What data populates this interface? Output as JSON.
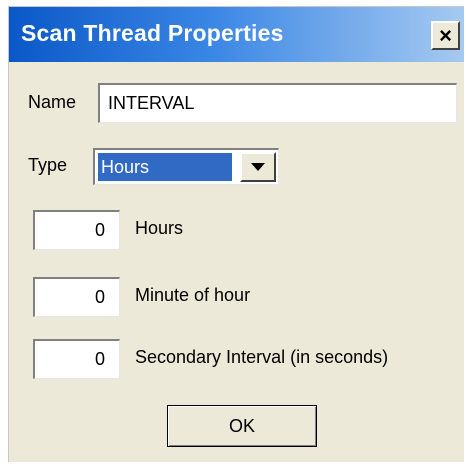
{
  "window": {
    "title": "Scan Thread Properties",
    "close_icon": "×"
  },
  "form": {
    "name_label": "Name",
    "name_value": "INTERVAL",
    "type_label": "Type",
    "type_value": "Hours",
    "hours_value": "0",
    "hours_label": "Hours",
    "minute_value": "0",
    "minute_label": "Minute of hour",
    "secondary_value": "0",
    "secondary_label": "Secondary Interval (in seconds)"
  },
  "buttons": {
    "ok_label": "OK"
  },
  "icons": {
    "close": "close-icon",
    "dropdown": "chevron-down-icon"
  },
  "colors": {
    "titlebar_start": "#0a58c8",
    "titlebar_end": "#a6caf0",
    "dialog_bg": "#ece9d8",
    "selection": "#316ac5"
  }
}
